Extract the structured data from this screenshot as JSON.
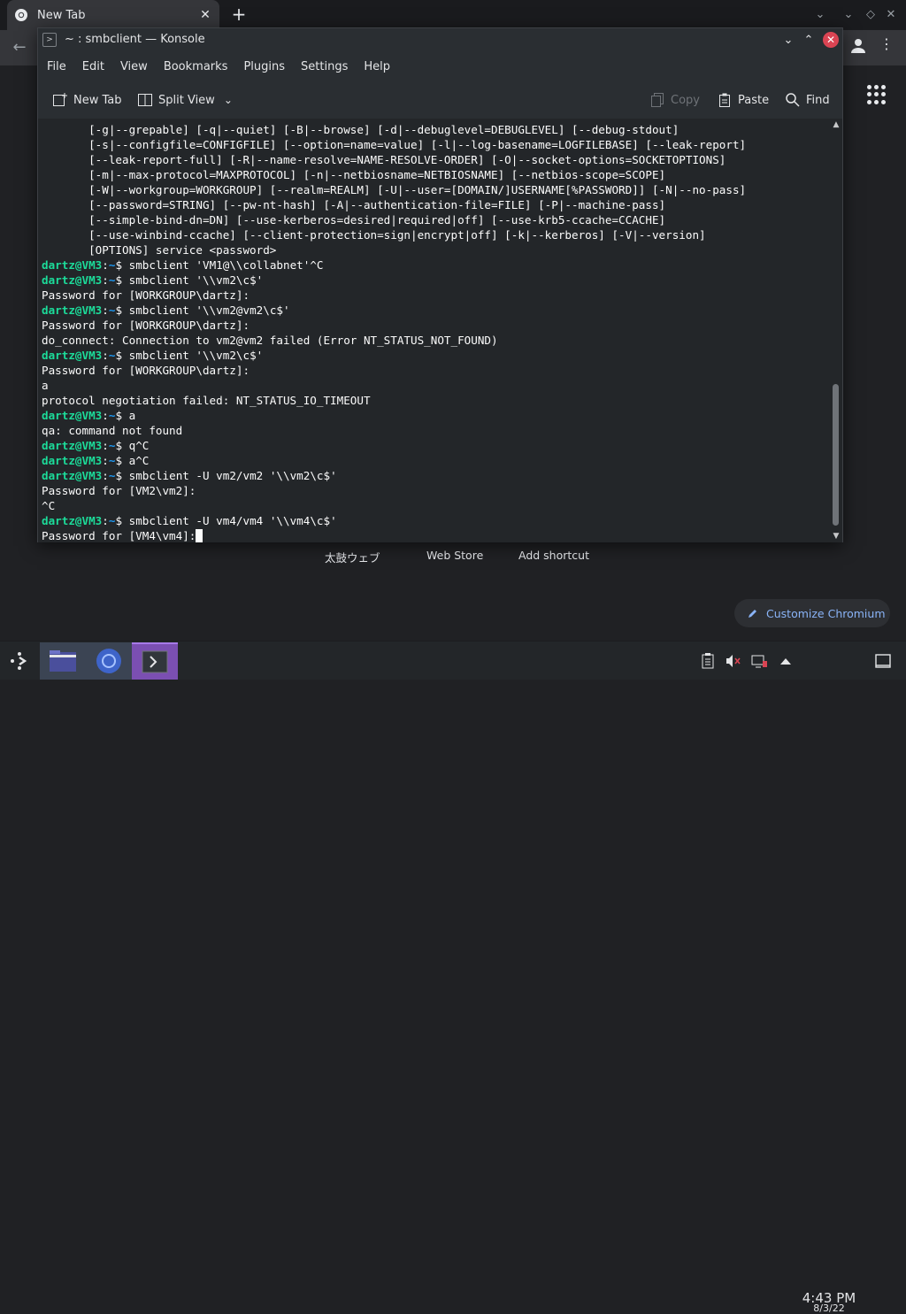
{
  "browser": {
    "tab_title": "New Tab",
    "shortcuts": [
      "太鼓ウェブ",
      "Web Store",
      "Add shortcut"
    ],
    "customize_label": "Customize Chromium"
  },
  "konsole": {
    "title": "~ : smbclient — Konsole",
    "menu": [
      "File",
      "Edit",
      "View",
      "Bookmarks",
      "Plugins",
      "Settings",
      "Help"
    ],
    "toolbar": {
      "new_tab": "New Tab",
      "split_view": "Split View",
      "copy": "Copy",
      "paste": "Paste",
      "find": "Find"
    },
    "prompt": {
      "user": "dartz@VM3",
      "sep": ":",
      "dir": "~",
      "sym": "$"
    },
    "lines": [
      {
        "text": "       [-g|--grepable] [-q|--quiet] [-B|--browse] [-d|--debuglevel=DEBUGLEVEL] [--debug-stdout]"
      },
      {
        "text": "       [-s|--configfile=CONFIGFILE] [--option=name=value] [-l|--log-basename=LOGFILEBASE] [--leak-report]"
      },
      {
        "text": "       [--leak-report-full] [-R|--name-resolve=NAME-RESOLVE-ORDER] [-O|--socket-options=SOCKETOPTIONS]"
      },
      {
        "text": "       [-m|--max-protocol=MAXPROTOCOL] [-n|--netbiosname=NETBIOSNAME] [--netbios-scope=SCOPE]"
      },
      {
        "text": "       [-W|--workgroup=WORKGROUP] [--realm=REALM] [-U|--user=[DOMAIN/]USERNAME[%PASSWORD]] [-N|--no-pass]"
      },
      {
        "text": "       [--password=STRING] [--pw-nt-hash] [-A|--authentication-file=FILE] [-P|--machine-pass]"
      },
      {
        "text": "       [--simple-bind-dn=DN] [--use-kerberos=desired|required|off] [--use-krb5-ccache=CCACHE]"
      },
      {
        "text": "       [--use-winbind-ccache] [--client-protection=sign|encrypt|off] [-k|--kerberos] [-V|--version]"
      },
      {
        "text": "       [OPTIONS] service <password>"
      },
      {
        "prompt": true,
        "text": " smbclient 'VM1@\\\\collabnet'^C"
      },
      {
        "prompt": true,
        "text": " smbclient '\\\\vm2\\c$'"
      },
      {
        "text": "Password for [WORKGROUP\\dartz]:"
      },
      {
        "prompt": true,
        "text": " smbclient '\\\\vm2@vm2\\c$'"
      },
      {
        "text": "Password for [WORKGROUP\\dartz]:"
      },
      {
        "text": "do_connect: Connection to vm2@vm2 failed (Error NT_STATUS_NOT_FOUND)"
      },
      {
        "prompt": true,
        "text": " smbclient '\\\\vm2\\c$'"
      },
      {
        "text": "Password for [WORKGROUP\\dartz]:"
      },
      {
        "text": "a"
      },
      {
        "text": "protocol negotiation failed: NT_STATUS_IO_TIMEOUT"
      },
      {
        "prompt": true,
        "text": " a"
      },
      {
        "text": "qa: command not found"
      },
      {
        "prompt": true,
        "text": " q^C"
      },
      {
        "prompt": true,
        "text": " a^C"
      },
      {
        "prompt": true,
        "text": " smbclient -U vm2/vm2 '\\\\vm2\\c$'"
      },
      {
        "text": "Password for [VM2\\vm2]:"
      },
      {
        "text": "^C"
      },
      {
        "prompt": true,
        "text": " smbclient -U vm4/vm4 '\\\\vm4\\c$'"
      },
      {
        "text": "Password for [VM4\\vm4]:",
        "cursor": true
      }
    ]
  },
  "taskbar": {
    "time": "4:43 PM",
    "date": "8/3/22"
  },
  "icons": {
    "chromium": "chromium-icon",
    "konsole": "konsole-icon",
    "files": "folder-icon"
  }
}
